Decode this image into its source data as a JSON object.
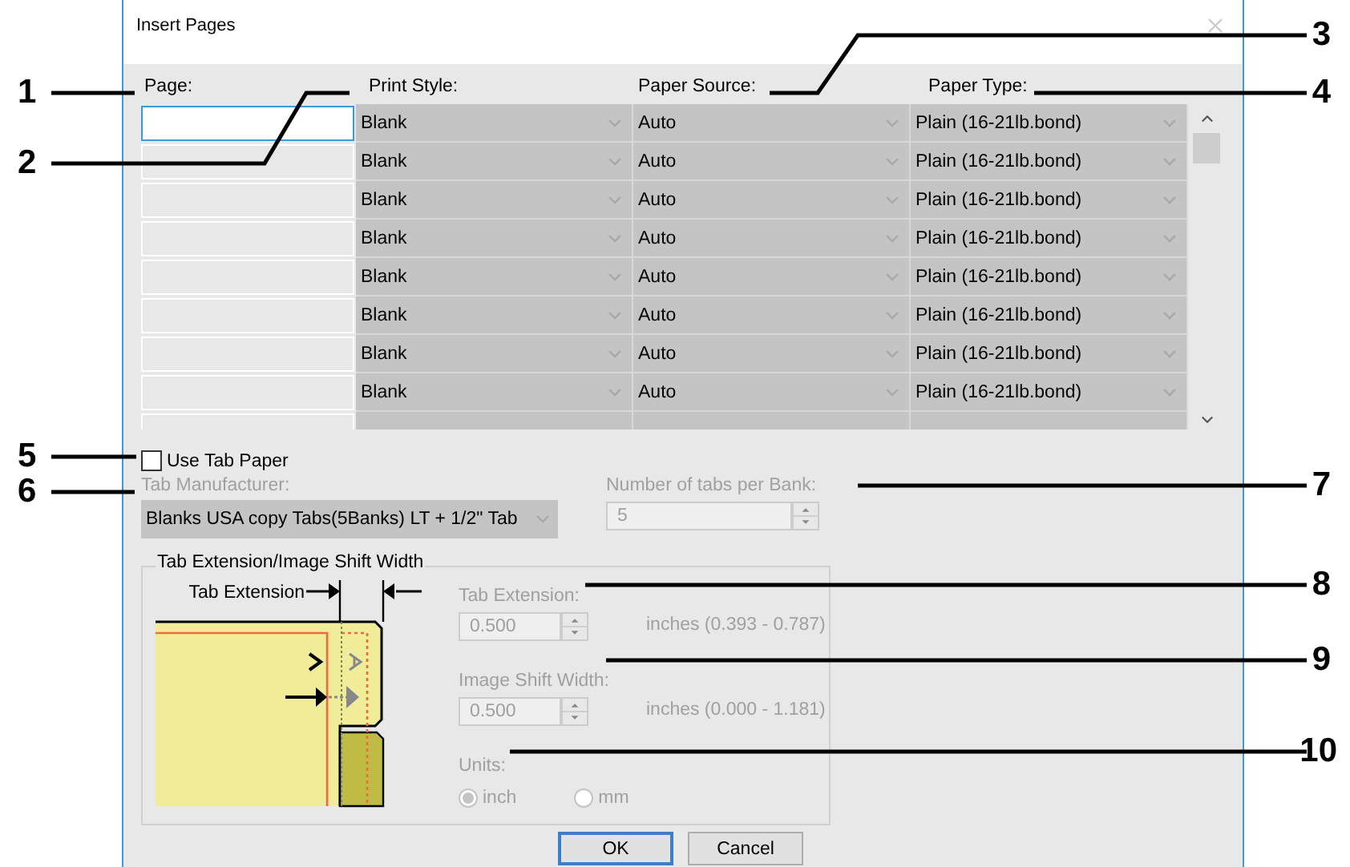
{
  "window": {
    "title": "Insert Pages"
  },
  "table": {
    "columns": [
      "Page:",
      "Print Style:",
      "Paper Source:",
      "Paper Type:"
    ],
    "rows": [
      {
        "selected": true,
        "print_style": "Blank",
        "paper_source": "Auto",
        "paper_type": "Plain (16-21lb.bond)"
      },
      {
        "selected": false,
        "print_style": "Blank",
        "paper_source": "Auto",
        "paper_type": "Plain (16-21lb.bond)"
      },
      {
        "selected": false,
        "print_style": "Blank",
        "paper_source": "Auto",
        "paper_type": "Plain (16-21lb.bond)"
      },
      {
        "selected": false,
        "print_style": "Blank",
        "paper_source": "Auto",
        "paper_type": "Plain (16-21lb.bond)"
      },
      {
        "selected": false,
        "print_style": "Blank",
        "paper_source": "Auto",
        "paper_type": "Plain (16-21lb.bond)"
      },
      {
        "selected": false,
        "print_style": "Blank",
        "paper_source": "Auto",
        "paper_type": "Plain (16-21lb.bond)"
      },
      {
        "selected": false,
        "print_style": "Blank",
        "paper_source": "Auto",
        "paper_type": "Plain (16-21lb.bond)"
      },
      {
        "selected": false,
        "print_style": "Blank",
        "paper_source": "Auto",
        "paper_type": "Plain (16-21lb.bond)"
      }
    ]
  },
  "use_tab_paper": {
    "label": "Use Tab Paper",
    "checked": false
  },
  "tab_manufacturer": {
    "label": "Tab Manufacturer:",
    "value": "Blanks USA copy Tabs(5Banks) LT + 1/2\"  Tab",
    "disabled": true
  },
  "tabs_per_bank": {
    "label": "Number of tabs per Bank:",
    "value": "5",
    "disabled": true
  },
  "group": {
    "title": "Tab Extension/Image Shift Width",
    "diagram_label": "Tab Extension",
    "fields": [
      {
        "label": "Tab Extension:",
        "value": "0.500",
        "range": "inches (0.393 - 0.787)",
        "disabled": true
      },
      {
        "label": "Image Shift Width:",
        "value": "0.500",
        "range": "inches (0.000 - 1.181)",
        "disabled": true
      }
    ],
    "units": {
      "label": "Units:",
      "disabled": true,
      "options": [
        {
          "label": "inch",
          "selected": true
        },
        {
          "label": "mm",
          "selected": false
        }
      ]
    }
  },
  "buttons": [
    {
      "label": "OK",
      "default": true
    },
    {
      "label": "Cancel",
      "default": false
    }
  ],
  "callouts": [
    {
      "number": "1"
    },
    {
      "number": "2"
    },
    {
      "number": "5"
    },
    {
      "number": "6"
    },
    {
      "number": "3"
    },
    {
      "number": "4"
    },
    {
      "number": "7"
    },
    {
      "number": "8"
    },
    {
      "number": "9"
    },
    {
      "number": "10"
    }
  ]
}
